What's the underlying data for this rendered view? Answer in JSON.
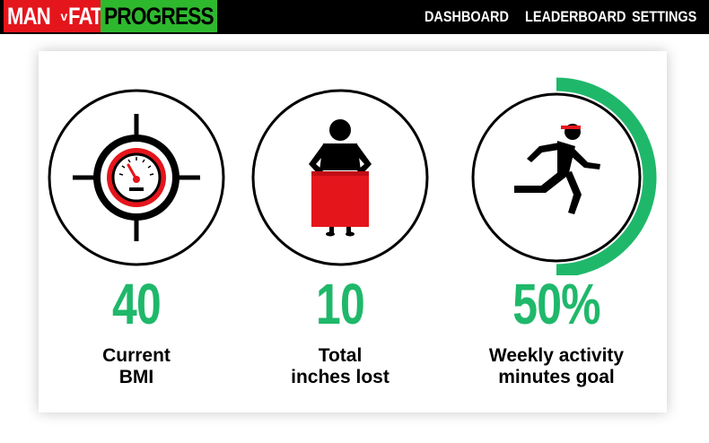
{
  "header": {
    "logo": {
      "part1": "MAN",
      "part2": "v",
      "part3": "FAT",
      "part4": "PROGRESS"
    },
    "nav": [
      {
        "label": "DASHBOARD"
      },
      {
        "label": "LEADERBOARD"
      },
      {
        "label": "SETTINGS"
      }
    ]
  },
  "stats": [
    {
      "icon": "target-gauge-icon",
      "value": "40",
      "label": "Current\nBMI"
    },
    {
      "icon": "loose-trousers-icon",
      "value": "10",
      "label": "Total\ninches lost"
    },
    {
      "icon": "running-man-icon",
      "value": "50%",
      "label": "Weekly activity\nminutes goal",
      "progress": 0.5
    }
  ],
  "colors": {
    "brand_red": "#e5151c",
    "brand_green": "#2eb82e",
    "accent_green": "#1fb86a",
    "black": "#000000"
  }
}
